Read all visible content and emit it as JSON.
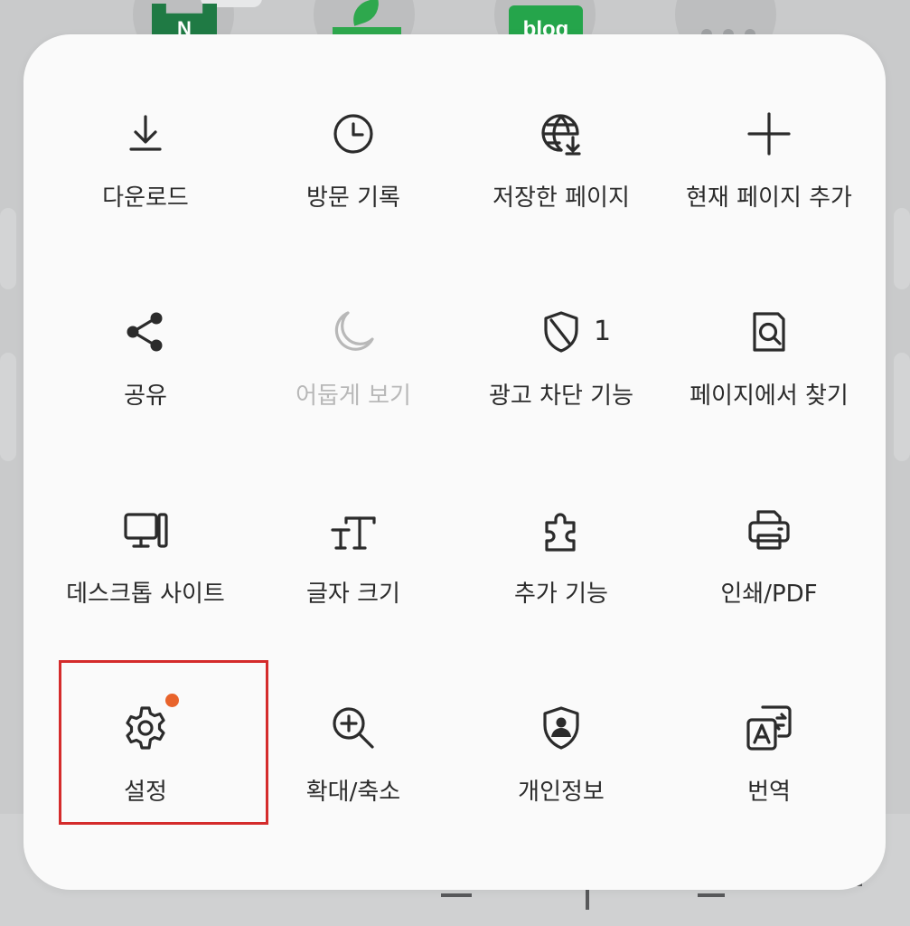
{
  "background": {
    "shortcut_logo_text": {
      "naver": "N",
      "blog": "blog"
    }
  },
  "menu": {
    "rows": [
      [
        {
          "id": "download",
          "label": "다운로드",
          "icon": "download-icon"
        },
        {
          "id": "history",
          "label": "방문 기록",
          "icon": "clock-icon"
        },
        {
          "id": "saved-pages",
          "label": "저장한 페이지",
          "icon": "globe-download-icon"
        },
        {
          "id": "add-page",
          "label": "현재 페이지 추가",
          "icon": "plus-icon"
        }
      ],
      [
        {
          "id": "share",
          "label": "공유",
          "icon": "share-icon"
        },
        {
          "id": "dark-mode",
          "label": "어둡게 보기",
          "icon": "moon-icon",
          "disabled": true
        },
        {
          "id": "ad-block",
          "label": "광고 차단 기능",
          "icon": "shield-slash-icon",
          "count": "1"
        },
        {
          "id": "find-in-page",
          "label": "페이지에서 찾기",
          "icon": "find-in-page-icon"
        }
      ],
      [
        {
          "id": "desktop-site",
          "label": "데스크톱 사이트",
          "icon": "desktop-icon"
        },
        {
          "id": "text-size",
          "label": "글자 크기",
          "icon": "text-size-icon"
        },
        {
          "id": "add-ons",
          "label": "추가 기능",
          "icon": "puzzle-icon"
        },
        {
          "id": "print",
          "label": "인쇄/PDF",
          "icon": "printer-icon"
        }
      ],
      [
        {
          "id": "settings",
          "label": "설정",
          "icon": "gear-icon",
          "notification": true
        },
        {
          "id": "zoom",
          "label": "확대/축소",
          "icon": "zoom-in-icon"
        },
        {
          "id": "privacy",
          "label": "개인정보",
          "icon": "privacy-shield-icon"
        },
        {
          "id": "translate",
          "label": "번역",
          "icon": "translate-icon"
        }
      ]
    ]
  },
  "colors": {
    "notification_dot": "#e8632b",
    "highlight_border": "#d42b2b",
    "disabled_text": "#b8b8b8"
  }
}
